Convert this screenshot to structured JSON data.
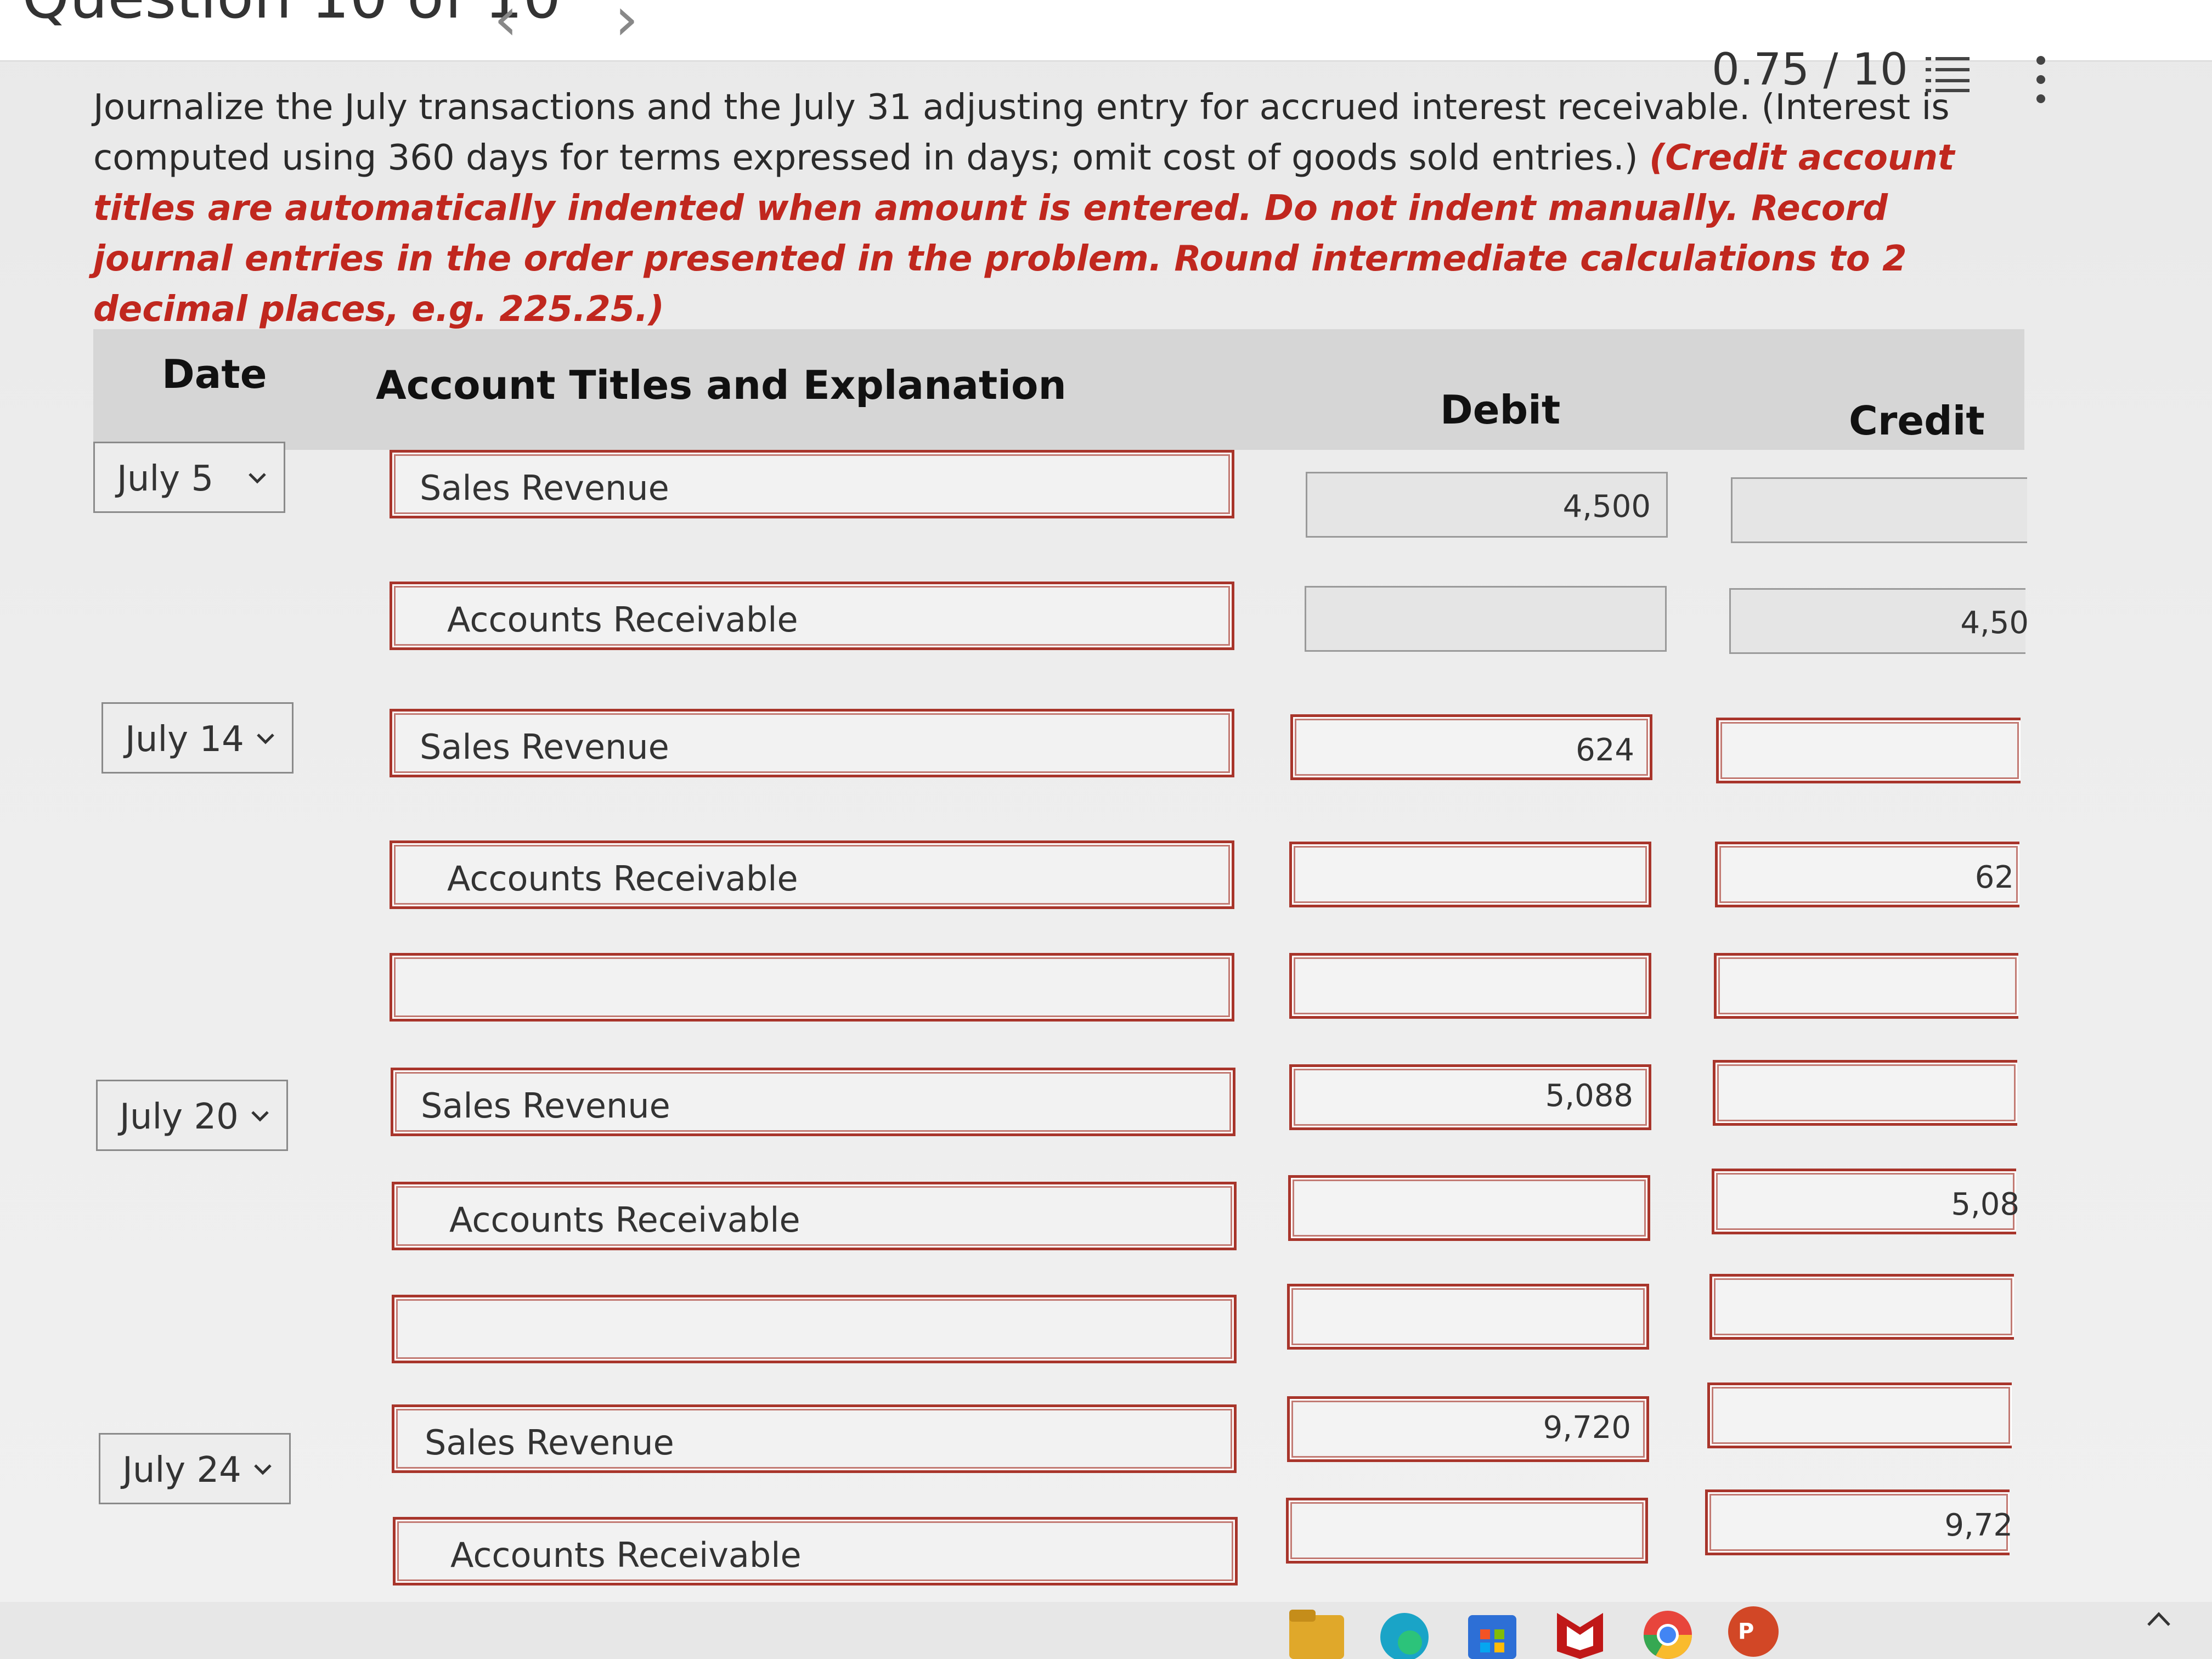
{
  "header": {
    "question_label": "Question 10 of 10",
    "score": "0.75 / 10",
    "icons": [
      "chevron-left-icon",
      "chevron-right-icon",
      "list-icon",
      "more-vertical-icon"
    ]
  },
  "instructions": {
    "text": "Journalize the July transactions and the July 31 adjusting entry for accrued interest receivable. (Interest is computed using 360 days for terms expressed in days; omit cost of goods sold entries.) ",
    "emphasis": "(Credit account titles are automatically indented when amount is entered. Do not indent manually. Record journal entries in the order presented in the problem. Round intermediate calculations to 2 decimal places, e.g. 225.25.)"
  },
  "table": {
    "headers": {
      "date": "Date",
      "account": "Account Titles and Explanation",
      "debit": "Debit",
      "credit": "Credit"
    },
    "dates": [
      "July 5",
      "July 14",
      "July 20",
      "July 24"
    ],
    "rows": [
      {
        "account": "Sales Revenue",
        "debit": "4,500",
        "credit": ""
      },
      {
        "account": "Accounts Receivable",
        "debit": "",
        "credit": "4,50"
      },
      {
        "account": "Sales Revenue",
        "debit": "624",
        "credit": ""
      },
      {
        "account": "Accounts Receivable",
        "debit": "",
        "credit": "62"
      },
      {
        "account": "",
        "debit": "",
        "credit": ""
      },
      {
        "account": "Sales Revenue",
        "debit": "5,088",
        "credit": ""
      },
      {
        "account": "Accounts Receivable",
        "debit": "",
        "credit": "5,08"
      },
      {
        "account": "",
        "debit": "",
        "credit": ""
      },
      {
        "account": "Sales Revenue",
        "debit": "9,720",
        "credit": ""
      },
      {
        "account": "Accounts Receivable",
        "debit": "",
        "credit": "9,72"
      }
    ]
  },
  "taskbar": {
    "icons": [
      "file-explorer-icon",
      "edge-icon",
      "store-icon",
      "mcafee-icon",
      "chrome-icon",
      "powerpoint-icon"
    ],
    "powerpoint_letter": "P",
    "colors": {
      "accent_red": "#c0271e",
      "field_border": "#a8352b"
    }
  }
}
